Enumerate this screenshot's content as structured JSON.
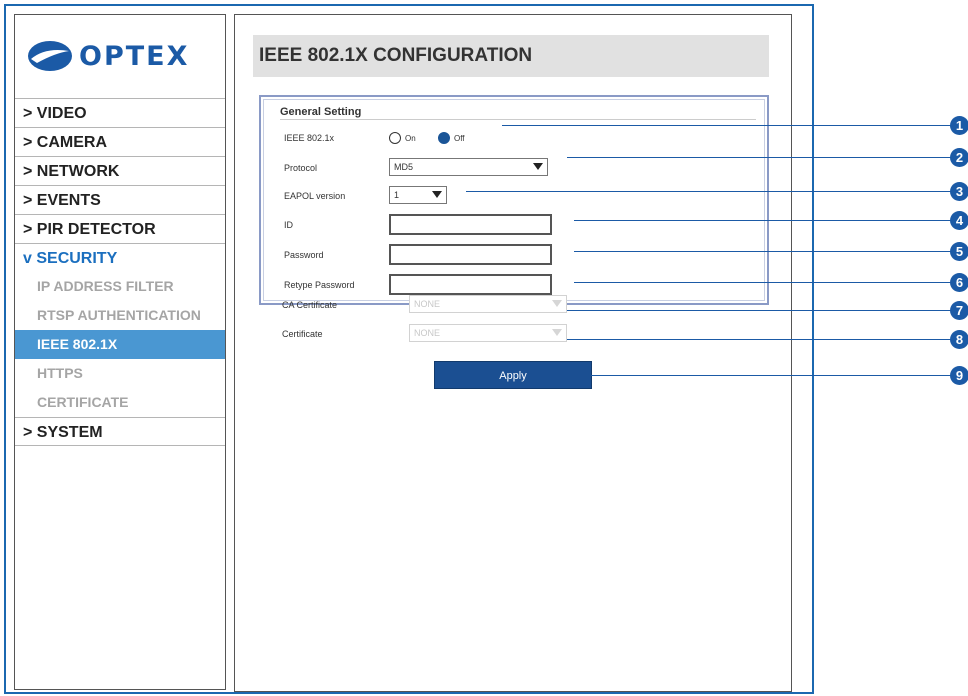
{
  "brand": {
    "logo_text": "OPTEX"
  },
  "sidebar": {
    "items": [
      {
        "label": "> VIDEO"
      },
      {
        "label": "> CAMERA"
      },
      {
        "label": "> NETWORK"
      },
      {
        "label": "> EVENTS"
      },
      {
        "label": "> PIR DETECTOR"
      },
      {
        "label": "v SECURITY",
        "expanded": true,
        "children": [
          {
            "label": "IP ADDRESS FILTER"
          },
          {
            "label": "RTSP AUTHENTICATION"
          },
          {
            "label": "IEEE 802.1X",
            "active": true
          },
          {
            "label": "HTTPS"
          },
          {
            "label": "CERTIFICATE"
          }
        ]
      },
      {
        "label": "> SYSTEM"
      }
    ]
  },
  "main": {
    "title": "IEEE 802.1X CONFIGURATION",
    "section_title": "General Setting",
    "fields": {
      "ieee": {
        "label": "IEEE 802.1x",
        "on_label": "On",
        "off_label": "Off",
        "selected": "Off"
      },
      "protocol": {
        "label": "Protocol",
        "value": "MD5"
      },
      "eapol": {
        "label": "EAPOL version",
        "value": "1"
      },
      "id": {
        "label": "ID",
        "value": ""
      },
      "password": {
        "label": "Password",
        "value": ""
      },
      "retype": {
        "label": "Retype Password",
        "value": ""
      },
      "ca_cert": {
        "label": "CA Certificate",
        "value": "NONE",
        "disabled": true
      },
      "cert": {
        "label": "Certificate",
        "value": "NONE",
        "disabled": true
      }
    },
    "apply_label": "Apply"
  },
  "callouts": [
    "1",
    "2",
    "3",
    "4",
    "5",
    "6",
    "7",
    "8",
    "9"
  ],
  "colors": {
    "accent": "#1b5aa6",
    "active_menu": "#4a97d2",
    "apply_button": "#1b4f92",
    "frame": "#1b68b0"
  }
}
